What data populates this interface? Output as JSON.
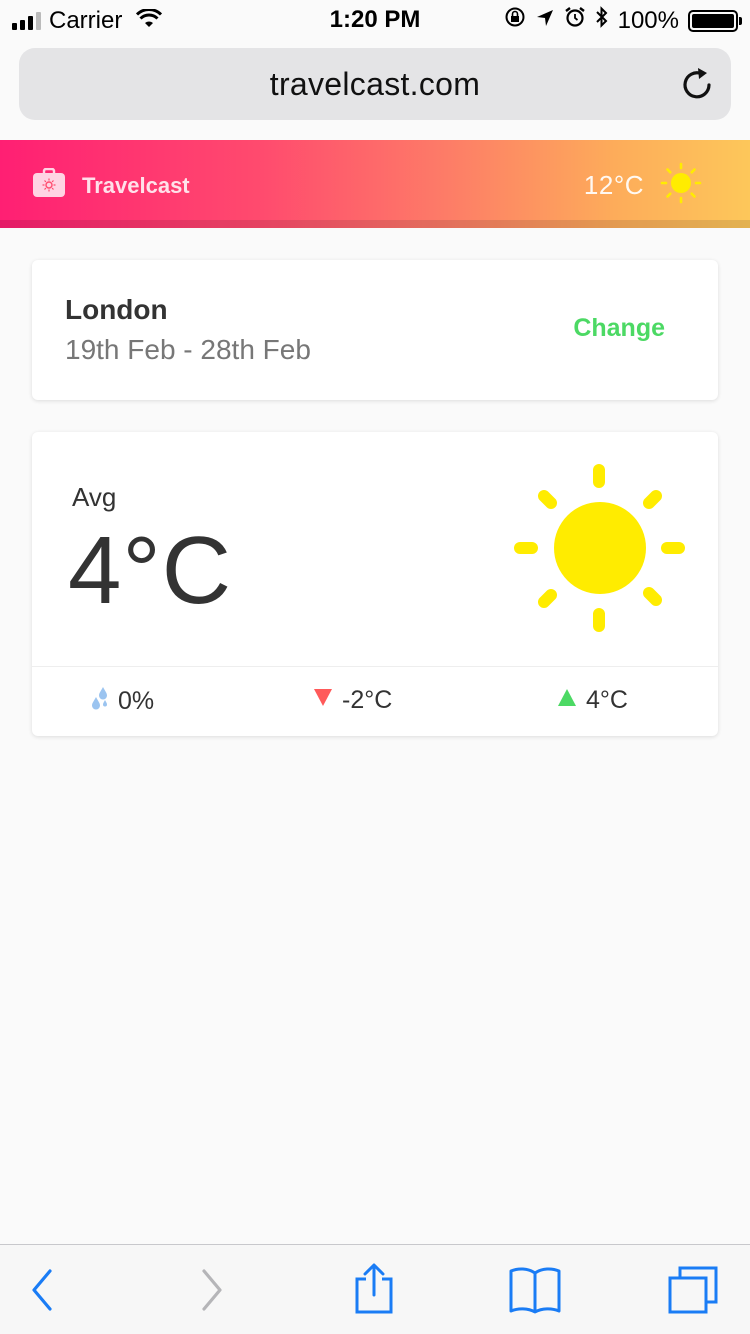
{
  "status_bar": {
    "carrier": "Carrier",
    "time": "1:20 PM",
    "battery": "100%"
  },
  "browser": {
    "url": "travelcast.com"
  },
  "header": {
    "app_name": "Travelcast",
    "current_temp": "12°C",
    "gradient_colors": [
      "#ff1f73",
      "#fd7d67",
      "#fdc75a"
    ]
  },
  "trip": {
    "city": "London",
    "dates": "19th Feb - 28th Feb",
    "change_label": "Change",
    "accent_color": "#4cd964"
  },
  "forecast": {
    "avg_label": "Avg",
    "avg_temp": "4°C",
    "icon": "sun-icon",
    "rain": "0%",
    "low": "-2°C",
    "high": "4°C",
    "low_color": "#ff5a5a",
    "high_color": "#4cd964",
    "sun_color": "#ffec00"
  },
  "toolbar": {
    "items": [
      "back-icon",
      "forward-icon",
      "share-icon",
      "bookmarks-icon",
      "tabs-icon"
    ]
  }
}
